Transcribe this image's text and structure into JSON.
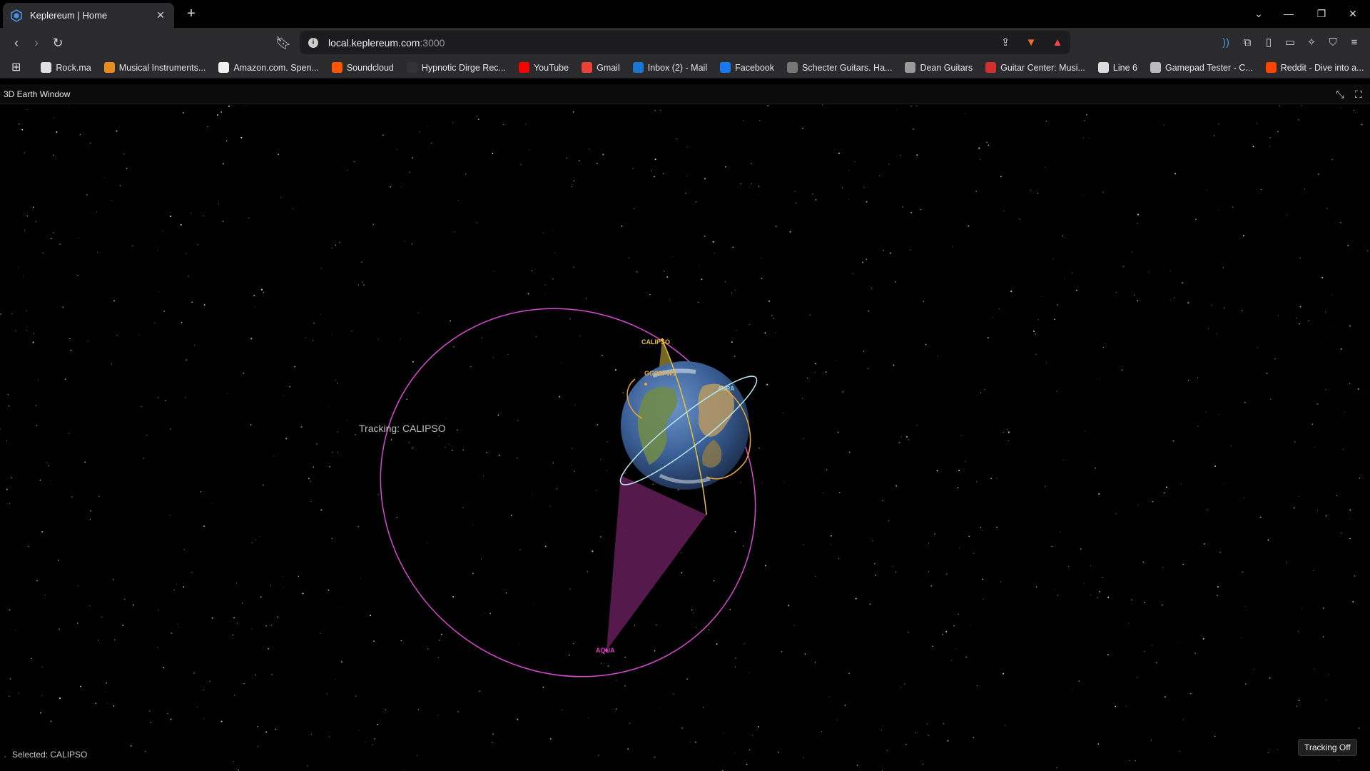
{
  "browser": {
    "tab_title": "Keplereum | Home",
    "url_host": "local.keplereum.com",
    "url_port": ":3000",
    "bookmarks": [
      {
        "label": "Rock.ma",
        "color": "#e0e0e0"
      },
      {
        "label": "Musical Instruments...",
        "color": "#e88c1f"
      },
      {
        "label": "Amazon.com. Spen...",
        "color": "#f0f0f0"
      },
      {
        "label": "Soundcloud",
        "color": "#ff5500"
      },
      {
        "label": "Hypnotic Dirge Rec...",
        "color": "#333333"
      },
      {
        "label": "YouTube",
        "color": "#ff0000"
      },
      {
        "label": "Gmail",
        "color": "#ea4335"
      },
      {
        "label": "Inbox (2) - Mail",
        "color": "#1976d2"
      },
      {
        "label": "Facebook",
        "color": "#1877f2"
      },
      {
        "label": "Schecter Guitars. Ha...",
        "color": "#777777"
      },
      {
        "label": "Dean Guitars",
        "color": "#999999"
      },
      {
        "label": "Guitar Center: Musi...",
        "color": "#d32f2f"
      },
      {
        "label": "Line 6",
        "color": "#dddddd"
      },
      {
        "label": "Gamepad Tester - C...",
        "color": "#bbbbbb"
      },
      {
        "label": "Reddit - Dive into a...",
        "color": "#ff4500"
      }
    ]
  },
  "app": {
    "window_title": "3D Earth Window",
    "tracking_text": "Tracking: CALIPSO",
    "selected_text": "Selected: CALIPSO",
    "tracking_button": "Tracking Off"
  },
  "satellites": [
    {
      "name": "CALIPSO",
      "color": "#e8c33a"
    },
    {
      "name": "GCOM-W1",
      "color": "#e8a83a"
    },
    {
      "name": "AURA",
      "color": "#9fd6e0"
    },
    {
      "name": "AQUA",
      "color": "#e040c8"
    }
  ],
  "colors": {
    "tab_bg": "#2b2b2e",
    "aqua_orbit": "#d84ad0",
    "aqua_cone": "#5a1a50",
    "calipso_orbit": "#e8c33a",
    "aura_orbit": "#b8e6ee"
  }
}
